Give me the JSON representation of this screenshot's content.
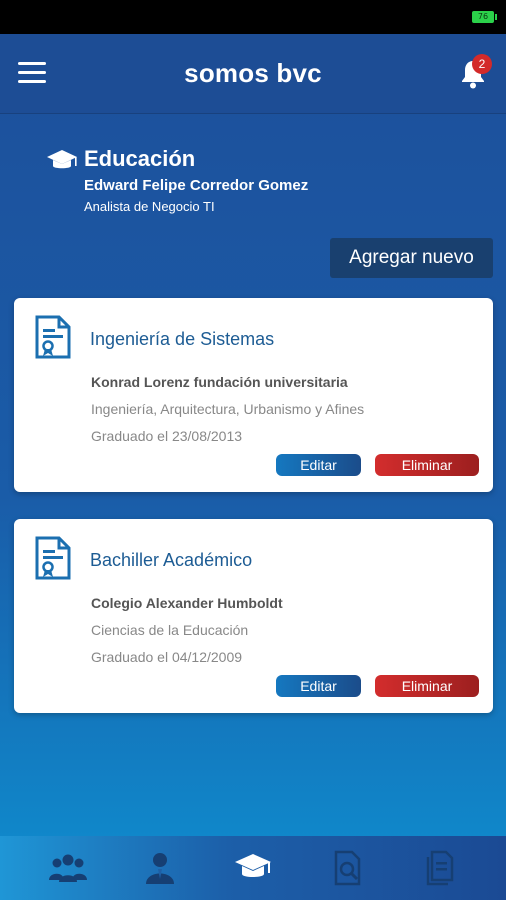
{
  "status_bar": {
    "battery": "76"
  },
  "header": {
    "brand": "somos bvc",
    "notification_count": "2"
  },
  "section": {
    "title": "Educación",
    "user_name": "Edward Felipe Corredor Gomez",
    "user_role": "Analista de Negocio TI"
  },
  "add_button_label": "Agregar nuevo",
  "cards": [
    {
      "title": "Ingeniería de Sistemas",
      "institution": "Konrad Lorenz fundación universitaria",
      "field": "Ingeniería, Arquitectura, Urbanismo y Afines",
      "graduated": "Graduado el 23/08/2013",
      "edit_label": "Editar",
      "delete_label": "Eliminar"
    },
    {
      "title": "Bachiller Académico",
      "institution": "Colegio Alexander Humboldt",
      "field": "Ciencias de la Educación",
      "graduated": "Graduado el 04/12/2009",
      "edit_label": "Editar",
      "delete_label": "Eliminar"
    }
  ],
  "tabs": [
    {
      "icon": "team-icon",
      "active": false
    },
    {
      "icon": "profile-icon",
      "active": false
    },
    {
      "icon": "graduation-cap-icon",
      "active": true
    },
    {
      "icon": "search-document-icon",
      "active": false
    },
    {
      "icon": "documents-icon",
      "active": false
    }
  ],
  "colors": {
    "header": "#1d4d95",
    "card_title": "#1d5c94",
    "edit_button": "#1578c0",
    "delete_button": "#d32d2d",
    "badge": "#d32a2a"
  }
}
